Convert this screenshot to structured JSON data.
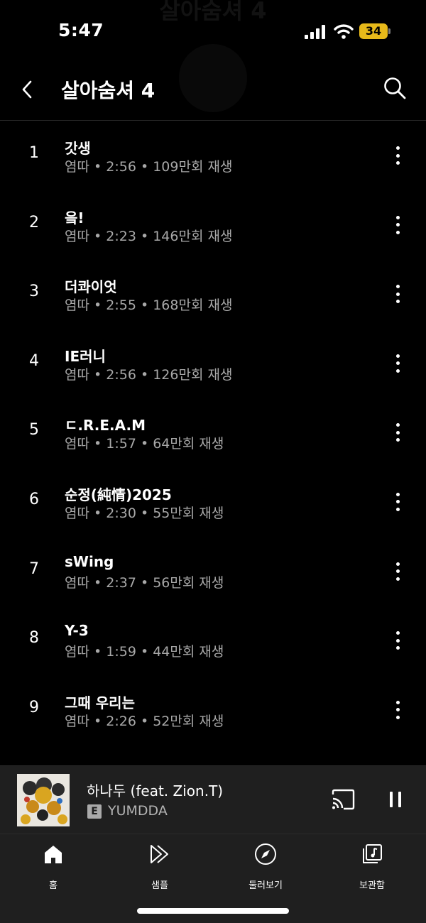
{
  "status_bar": {
    "time": "5:47",
    "battery": "34"
  },
  "background_art": {
    "title": "살아숨셔 4"
  },
  "header": {
    "title": "살아숨셔 4"
  },
  "tracks": [
    {
      "num": "1",
      "title": "갓생",
      "meta": "염따 • 2:56 • 109만회 재생"
    },
    {
      "num": "2",
      "title": "읔!",
      "meta": "염따 • 2:23 • 146만회 재생"
    },
    {
      "num": "3",
      "title": "더콰이엇",
      "meta": "염따 • 2:55 • 168만회 재생"
    },
    {
      "num": "4",
      "title": "IE러니",
      "meta": "염따 • 2:56 • 126만회 재생"
    },
    {
      "num": "5",
      "title": "ㄷ.R.E.A.M",
      "meta": "염따 • 1:57 • 64만회 재생"
    },
    {
      "num": "6",
      "title": "순정(純情)2025",
      "meta": "염따 • 2:30 • 55만회 재생"
    },
    {
      "num": "7",
      "title": "sWing",
      "meta": "염따 • 2:37 • 56만회 재생"
    },
    {
      "num": "8",
      "title": "Y-3",
      "meta": "염따 • 1:59 • 44만회 재생"
    },
    {
      "num": "9",
      "title": "그때 우리는",
      "meta": "염따 • 2:26 • 52만회 재생"
    }
  ],
  "mini_player": {
    "title": "하나두 (feat. Zion.T)",
    "explicit": "E",
    "artist": "YUMDDA"
  },
  "bottom_nav": [
    {
      "label": "홈",
      "icon": "home-icon"
    },
    {
      "label": "샘플",
      "icon": "samples-icon"
    },
    {
      "label": "둘러보기",
      "icon": "explore-icon"
    },
    {
      "label": "보관함",
      "icon": "library-icon"
    }
  ],
  "colors": {
    "background": "#000000",
    "secondary_text": "#a8a8a8",
    "battery": "#e7b91a",
    "player_bg": "#1f1f1f"
  }
}
